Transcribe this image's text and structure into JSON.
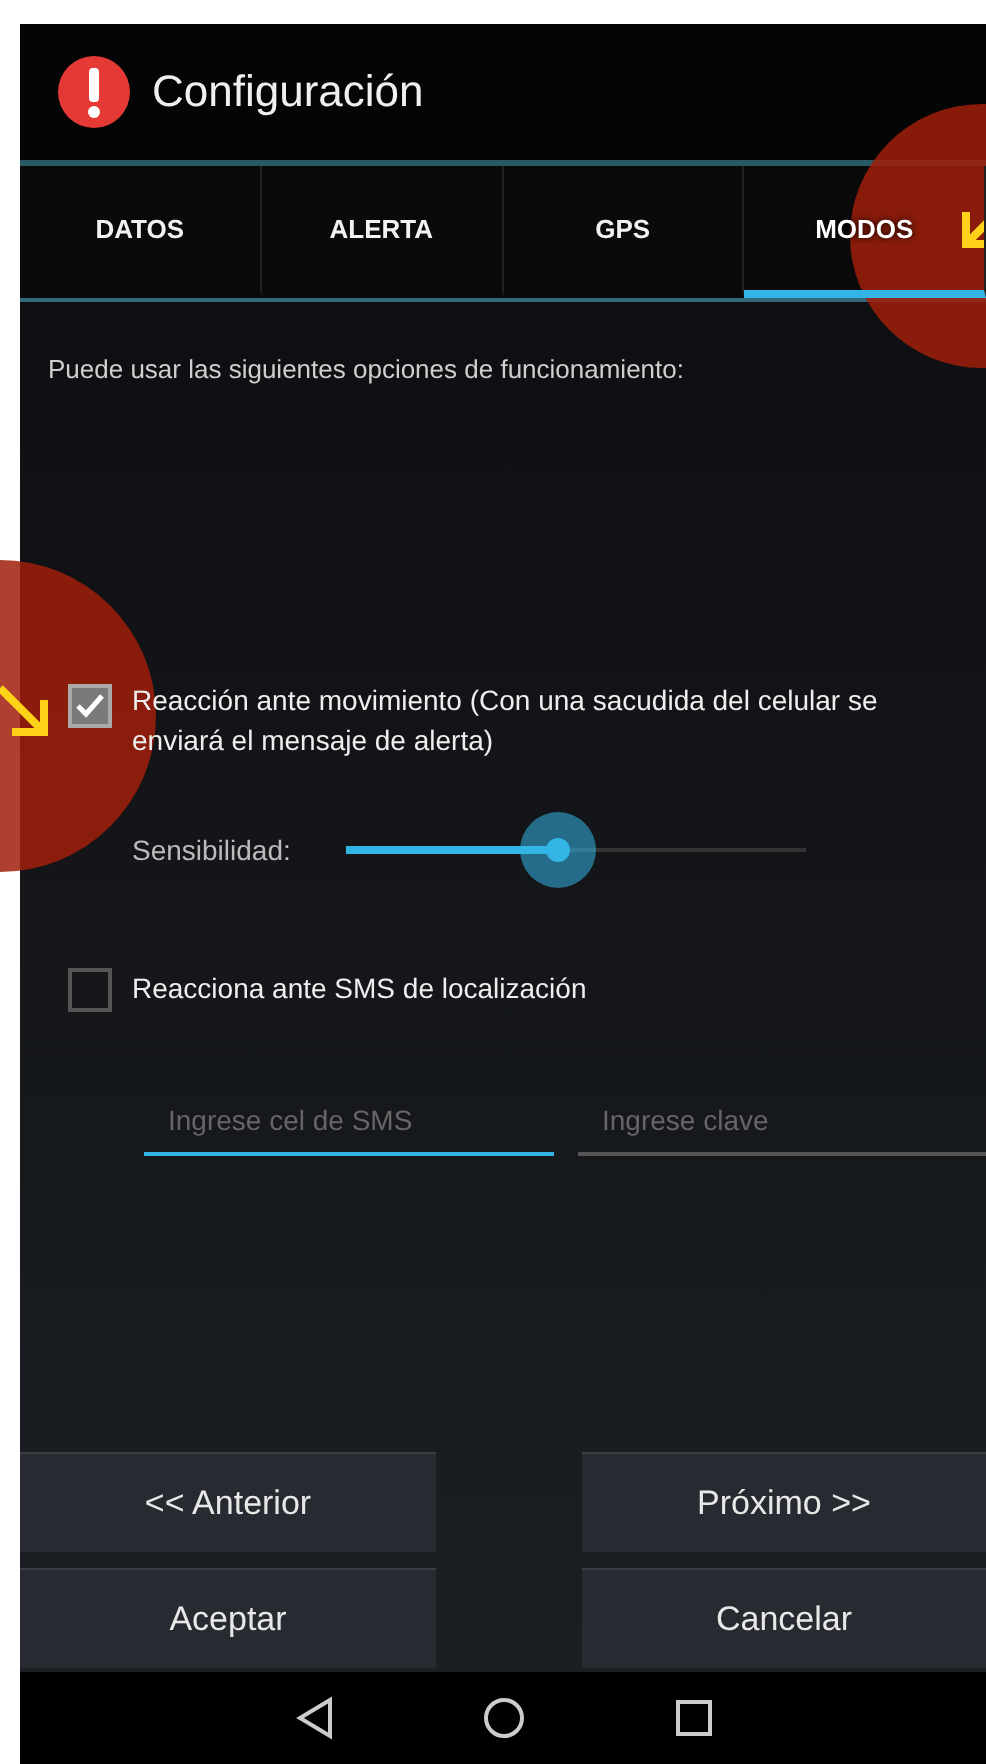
{
  "action_bar": {
    "title": "Configuración"
  },
  "tabs": [
    {
      "label": "DATOS",
      "selected": false
    },
    {
      "label": "ALERTA",
      "selected": false
    },
    {
      "label": "GPS",
      "selected": false
    },
    {
      "label": "MODOS",
      "selected": true
    }
  ],
  "intro": "Puede usar las siguientes opciones de funcionamiento:",
  "motion_option": {
    "label": "Reacción ante movimiento (Con una sacudida del celular se enviará el mensaje de alerta)",
    "checked": true
  },
  "sensitivity": {
    "label": "Sensibilidad:",
    "level": 0.46
  },
  "sms_option": {
    "label": "Reacciona ante SMS de localización",
    "checked": false
  },
  "fields": [
    {
      "placeholder": "Ingrese cel de SMS",
      "focused": true
    },
    {
      "placeholder": "Ingrese clave",
      "focused": false
    }
  ],
  "buttons": [
    [
      "<< Anterior",
      "Próximo >>"
    ],
    [
      "Aceptar",
      "Cancelar"
    ]
  ],
  "annotations": [
    {
      "kind": "southwest"
    },
    {
      "kind": "southeast"
    }
  ]
}
